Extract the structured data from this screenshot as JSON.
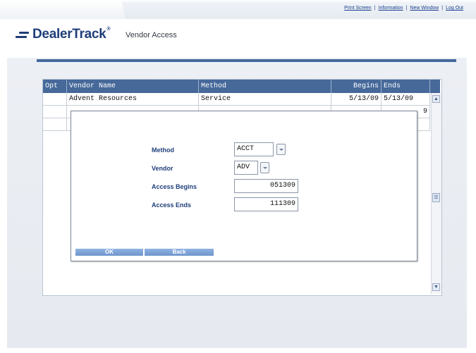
{
  "header": {
    "links": [
      {
        "label": "Print Screen"
      },
      {
        "label": "Information"
      },
      {
        "label": "New Window"
      },
      {
        "label": "Log Out"
      }
    ],
    "logo": {
      "part1": "Dealer",
      "part2": "Track",
      "reg": "®"
    },
    "subtitle": "Vendor Access"
  },
  "table": {
    "columns": [
      "Opt",
      "Vendor Name",
      "Method",
      "Begins",
      "Ends"
    ],
    "rows": [
      {
        "opt": "",
        "vendor": "Advent Resources",
        "method": "Service",
        "begins": "5/13/09",
        "ends": "5/13/09"
      },
      {
        "opt": "",
        "vendor": "",
        "method": "",
        "begins": "",
        "ends": "9"
      },
      {
        "opt": "",
        "vendor": "",
        "method": "",
        "begins": "",
        "ends": ""
      }
    ]
  },
  "modal": {
    "method_label": "Method",
    "method_value": "ACCT",
    "vendor_label": "Vendor",
    "vendor_value": "ADV",
    "begins_label": "Access Begins",
    "begins_value": "051309",
    "ends_label": "Access Ends",
    "ends_value": "111309",
    "ok_label": "OK",
    "back_label": "Back"
  },
  "colors": {
    "brand": "#1f3e7a",
    "table_header": "#46699a",
    "button": "#7fa4d8"
  }
}
